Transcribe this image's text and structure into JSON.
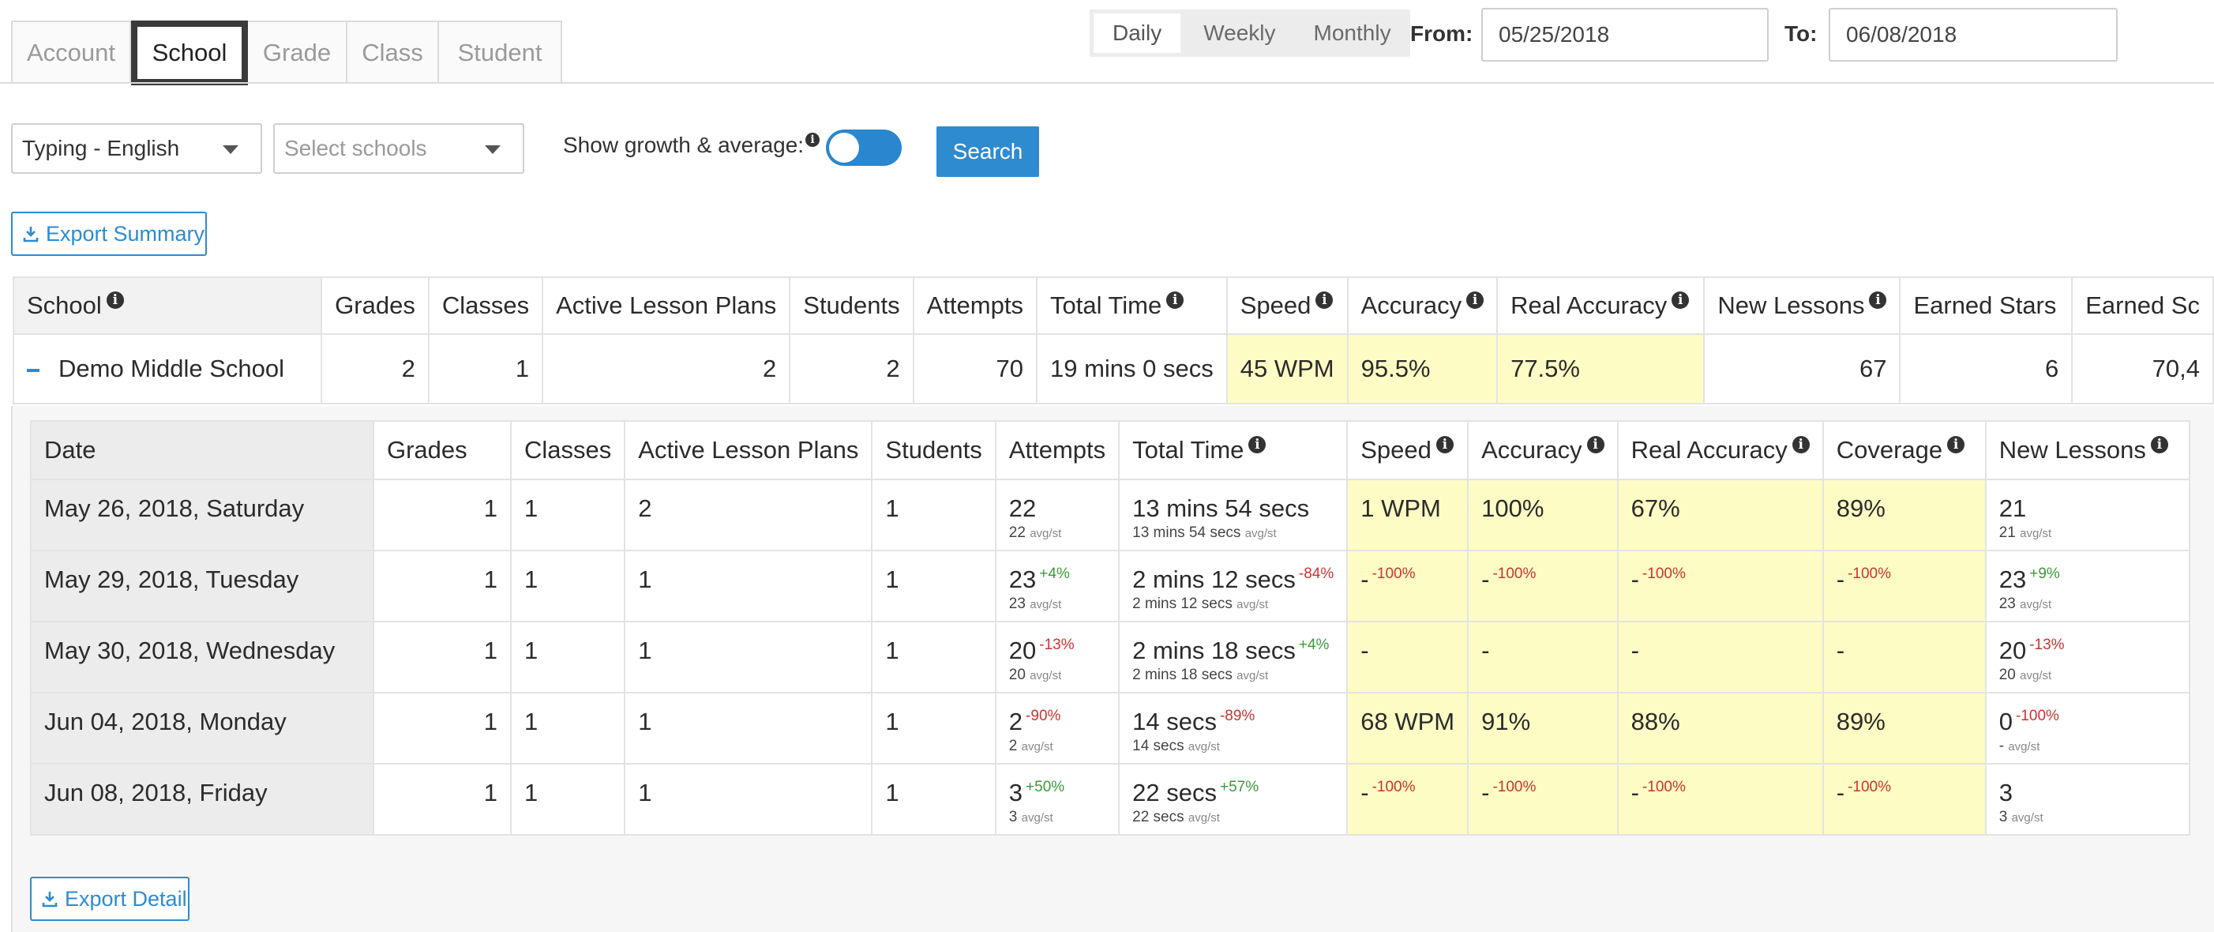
{
  "tabs": [
    "Account",
    "School",
    "Grade",
    "Class",
    "Student"
  ],
  "period": {
    "options": [
      "Daily",
      "Weekly",
      "Monthly"
    ],
    "active": "Daily"
  },
  "date_range": {
    "from_label": "From:",
    "from_value": "05/25/2018",
    "to_label": "To:",
    "to_value": "06/08/2018"
  },
  "filters": {
    "course": "Typing - English",
    "schools_placeholder": "Select schools",
    "growth_label": "Show growth & average:",
    "growth_enabled": true,
    "search_label": "Search"
  },
  "export_summary_label": "Export Summary",
  "export_detail_label": "Export Detail",
  "summary": {
    "headers": [
      "School",
      "Grades",
      "Classes",
      "Active Lesson Plans",
      "Students",
      "Attempts",
      "Total Time",
      "Speed",
      "Accuracy",
      "Real Accuracy",
      "New Lessons",
      "Earned Stars",
      "Earned Sc"
    ],
    "row": {
      "school": "Demo Middle School",
      "grades": "2",
      "classes": "1",
      "active_lesson_plans": "2",
      "students": "2",
      "attempts": "70",
      "total_time": "19 mins 0 secs",
      "speed": "45 WPM",
      "accuracy": "95.5%",
      "real_accuracy": "77.5%",
      "new_lessons": "67",
      "earned_stars": "6",
      "earned_score": "70,4"
    }
  },
  "detail": {
    "headers": [
      "Date",
      "Grades",
      "Classes",
      "Active Lesson Plans",
      "Students",
      "Attempts",
      "Total Time",
      "Speed",
      "Accuracy",
      "Real Accuracy",
      "Coverage",
      "New Lessons"
    ],
    "avg_unit": "avg/st",
    "rows": [
      {
        "date": "May 26, 2018, Saturday",
        "grades": "1",
        "classes": "1",
        "plans": "2",
        "students": "1",
        "attempts": "22",
        "attempts_delta": "",
        "attempts_avg": "22",
        "time": "13 mins 54 secs",
        "time_delta": "",
        "time_avg": "13 mins 54 secs",
        "speed": "1 WPM",
        "speed_delta": "",
        "accuracy": "100%",
        "accuracy_delta": "",
        "real_accuracy": "67%",
        "real_accuracy_delta": "",
        "coverage": "89%",
        "coverage_delta": "",
        "lessons": "21",
        "lessons_delta": "",
        "lessons_avg": "21"
      },
      {
        "date": "May 29, 2018, Tuesday",
        "grades": "1",
        "classes": "1",
        "plans": "1",
        "students": "1",
        "attempts": "23",
        "attempts_delta": "+4%",
        "attempts_avg": "23",
        "time": "2 mins 12 secs",
        "time_delta": "-84%",
        "time_avg": "2 mins 12 secs",
        "speed": "-",
        "speed_delta": "-100%",
        "accuracy": "-",
        "accuracy_delta": "-100%",
        "real_accuracy": "-",
        "real_accuracy_delta": "-100%",
        "coverage": "-",
        "coverage_delta": "-100%",
        "lessons": "23",
        "lessons_delta": "+9%",
        "lessons_avg": "23"
      },
      {
        "date": "May 30, 2018, Wednesday",
        "grades": "1",
        "classes": "1",
        "plans": "1",
        "students": "1",
        "attempts": "20",
        "attempts_delta": "-13%",
        "attempts_avg": "20",
        "time": "2 mins 18 secs",
        "time_delta": "+4%",
        "time_avg": "2 mins 18 secs",
        "speed": "-",
        "speed_delta": "",
        "accuracy": "-",
        "accuracy_delta": "",
        "real_accuracy": "-",
        "real_accuracy_delta": "",
        "coverage": "-",
        "coverage_delta": "",
        "lessons": "20",
        "lessons_delta": "-13%",
        "lessons_avg": "20"
      },
      {
        "date": "Jun 04, 2018, Monday",
        "grades": "1",
        "classes": "1",
        "plans": "1",
        "students": "1",
        "attempts": "2",
        "attempts_delta": "-90%",
        "attempts_avg": "2",
        "time": "14 secs",
        "time_delta": "-89%",
        "time_avg": "14 secs",
        "speed": "68 WPM",
        "speed_delta": "",
        "accuracy": "91%",
        "accuracy_delta": "",
        "real_accuracy": "88%",
        "real_accuracy_delta": "",
        "coverage": "89%",
        "coverage_delta": "",
        "lessons": "0",
        "lessons_delta": "-100%",
        "lessons_avg": "-"
      },
      {
        "date": "Jun 08, 2018, Friday",
        "grades": "1",
        "classes": "1",
        "plans": "1",
        "students": "1",
        "attempts": "3",
        "attempts_delta": "+50%",
        "attempts_avg": "3",
        "time": "22 secs",
        "time_delta": "+57%",
        "time_avg": "22 secs",
        "speed": "-",
        "speed_delta": "-100%",
        "accuracy": "-",
        "accuracy_delta": "-100%",
        "real_accuracy": "-",
        "real_accuracy_delta": "-100%",
        "coverage": "-",
        "coverage_delta": "-100%",
        "lessons": "3",
        "lessons_delta": "",
        "lessons_avg": "3"
      }
    ]
  },
  "colors": {
    "accent": "#2e8bd0",
    "highlight": "#fdfcc4",
    "growth": "#3a9a3a",
    "decline": "#cc3333"
  },
  "icons": [
    "download-icon",
    "info-icon",
    "minus-icon",
    "caret-down-icon"
  ]
}
